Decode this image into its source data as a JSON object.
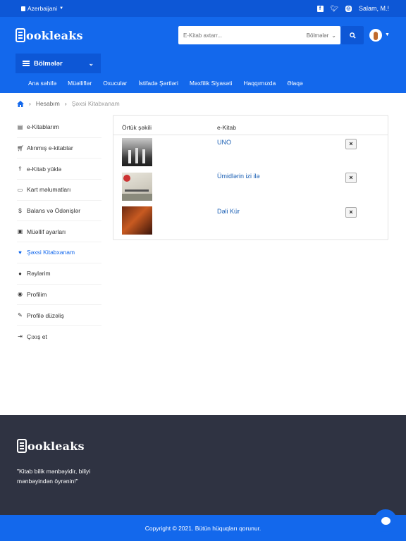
{
  "topbar": {
    "language": "Azerbaijani",
    "greeting": "Salam, M.!"
  },
  "header": {
    "logo": "ookleaks",
    "search_placeholder": "E-Kitab axtarr...",
    "category_select": "Bölmələr"
  },
  "navbar": {
    "sections_label": "Bölmələr",
    "menu": [
      "Ana səhifə",
      "Müəlliflər",
      "Oxucular",
      "İstifadə Şərtləri",
      "Məxfilik Siyasəti",
      "Haqqımızda",
      "Əlaqə"
    ]
  },
  "breadcrumb": {
    "account": "Hesabım",
    "current": "Şəxsi Kitabxanam"
  },
  "sidebar": {
    "items": [
      {
        "label": "e-Kitablarım",
        "icon": "book-icon"
      },
      {
        "label": "Alınmış e-kitablar",
        "icon": "cart-icon"
      },
      {
        "label": "e-Kitab yüklə",
        "icon": "upload-icon"
      },
      {
        "label": "Kart məlumatları",
        "icon": "credit-card-icon"
      },
      {
        "label": "Balans və Ödənişlər",
        "icon": "dollar-icon"
      },
      {
        "label": "Müəllif ayarları",
        "icon": "user-square-icon"
      },
      {
        "label": "Şəxsi Kitabxanam",
        "icon": "heart-icon"
      },
      {
        "label": "Rəylərim",
        "icon": "comment-icon"
      },
      {
        "label": "Profilim",
        "icon": "user-circle-icon"
      },
      {
        "label": "Profilə düzəliş",
        "icon": "edit-icon"
      },
      {
        "label": "Çıxış et",
        "icon": "sign-out-icon"
      }
    ]
  },
  "library": {
    "headers": {
      "cover": "Örtük şəkili",
      "book": "e-Kitab"
    },
    "rows": [
      {
        "title": "UNO"
      },
      {
        "title": "Ümidlərin izi ilə"
      },
      {
        "title": "Dəli Kür"
      }
    ],
    "remove_symbol": "×"
  },
  "footer": {
    "logo": "ookleaks",
    "quote": "\"Kitab bilik mənbəyidir, biliyi mənbəyindən öyrənin!\"",
    "copyright": "Copyright © 2021. Bütün hüquqları qorunur."
  },
  "colors": {
    "primary": "#1368ec",
    "dark_primary": "#0d57d6",
    "footer_bg": "#2f3342",
    "link": "#1a5fb4"
  }
}
